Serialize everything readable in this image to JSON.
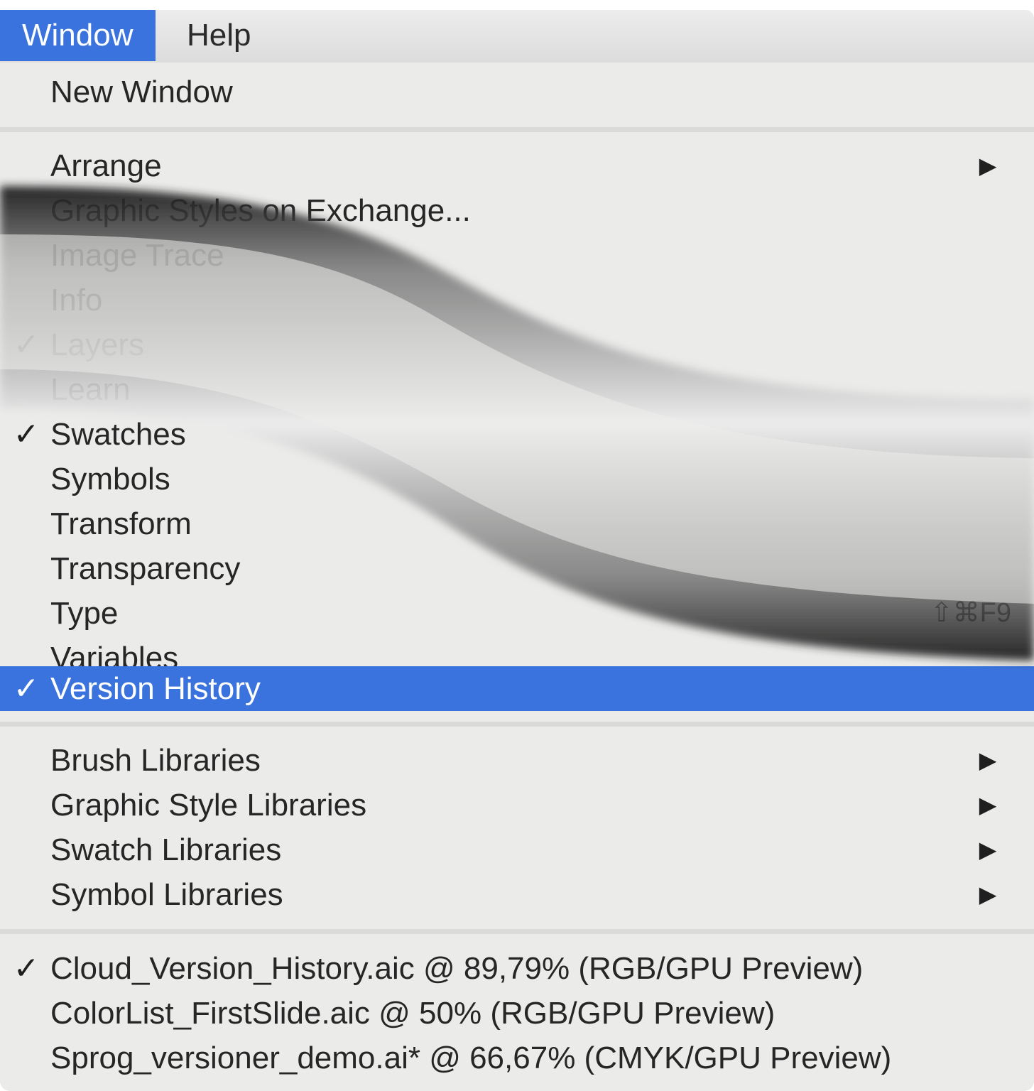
{
  "menubar": {
    "window_label": "Window",
    "help_label": "Help"
  },
  "menu": {
    "new_window": "New Window",
    "arrange": "Arrange",
    "graphic_styles_exchange": "Graphic Styles on Exchange...",
    "image_trace": "Image Trace",
    "info": "Info",
    "layers": "Layers",
    "learn": "Learn",
    "swatches": "Swatches",
    "symbols": "Symbols",
    "transform": "Transform",
    "transparency": "Transparency",
    "type": "Type",
    "type_shortcut": "⇧⌘F9",
    "variables": "Variables",
    "version_history": "Version History",
    "brush_libraries": "Brush Libraries",
    "graphic_style_libraries": "Graphic Style Libraries",
    "swatch_libraries": "Swatch Libraries",
    "symbol_libraries": "Symbol Libraries"
  },
  "documents": [
    {
      "label": "Cloud_Version_History.aic @ 89,79% (RGB/GPU Preview)",
      "checked": true
    },
    {
      "label": "ColorList_FirstSlide.aic @ 50% (RGB/GPU Preview)",
      "checked": false
    },
    {
      "label": "Sprog_versioner_demo.ai* @ 66,67% (CMYK/GPU Preview)",
      "checked": false
    }
  ],
  "glyphs": {
    "check": "✓",
    "arrow": "▶"
  },
  "colors": {
    "highlight": "#3a73dd",
    "menu_bg": "#ebebea"
  }
}
